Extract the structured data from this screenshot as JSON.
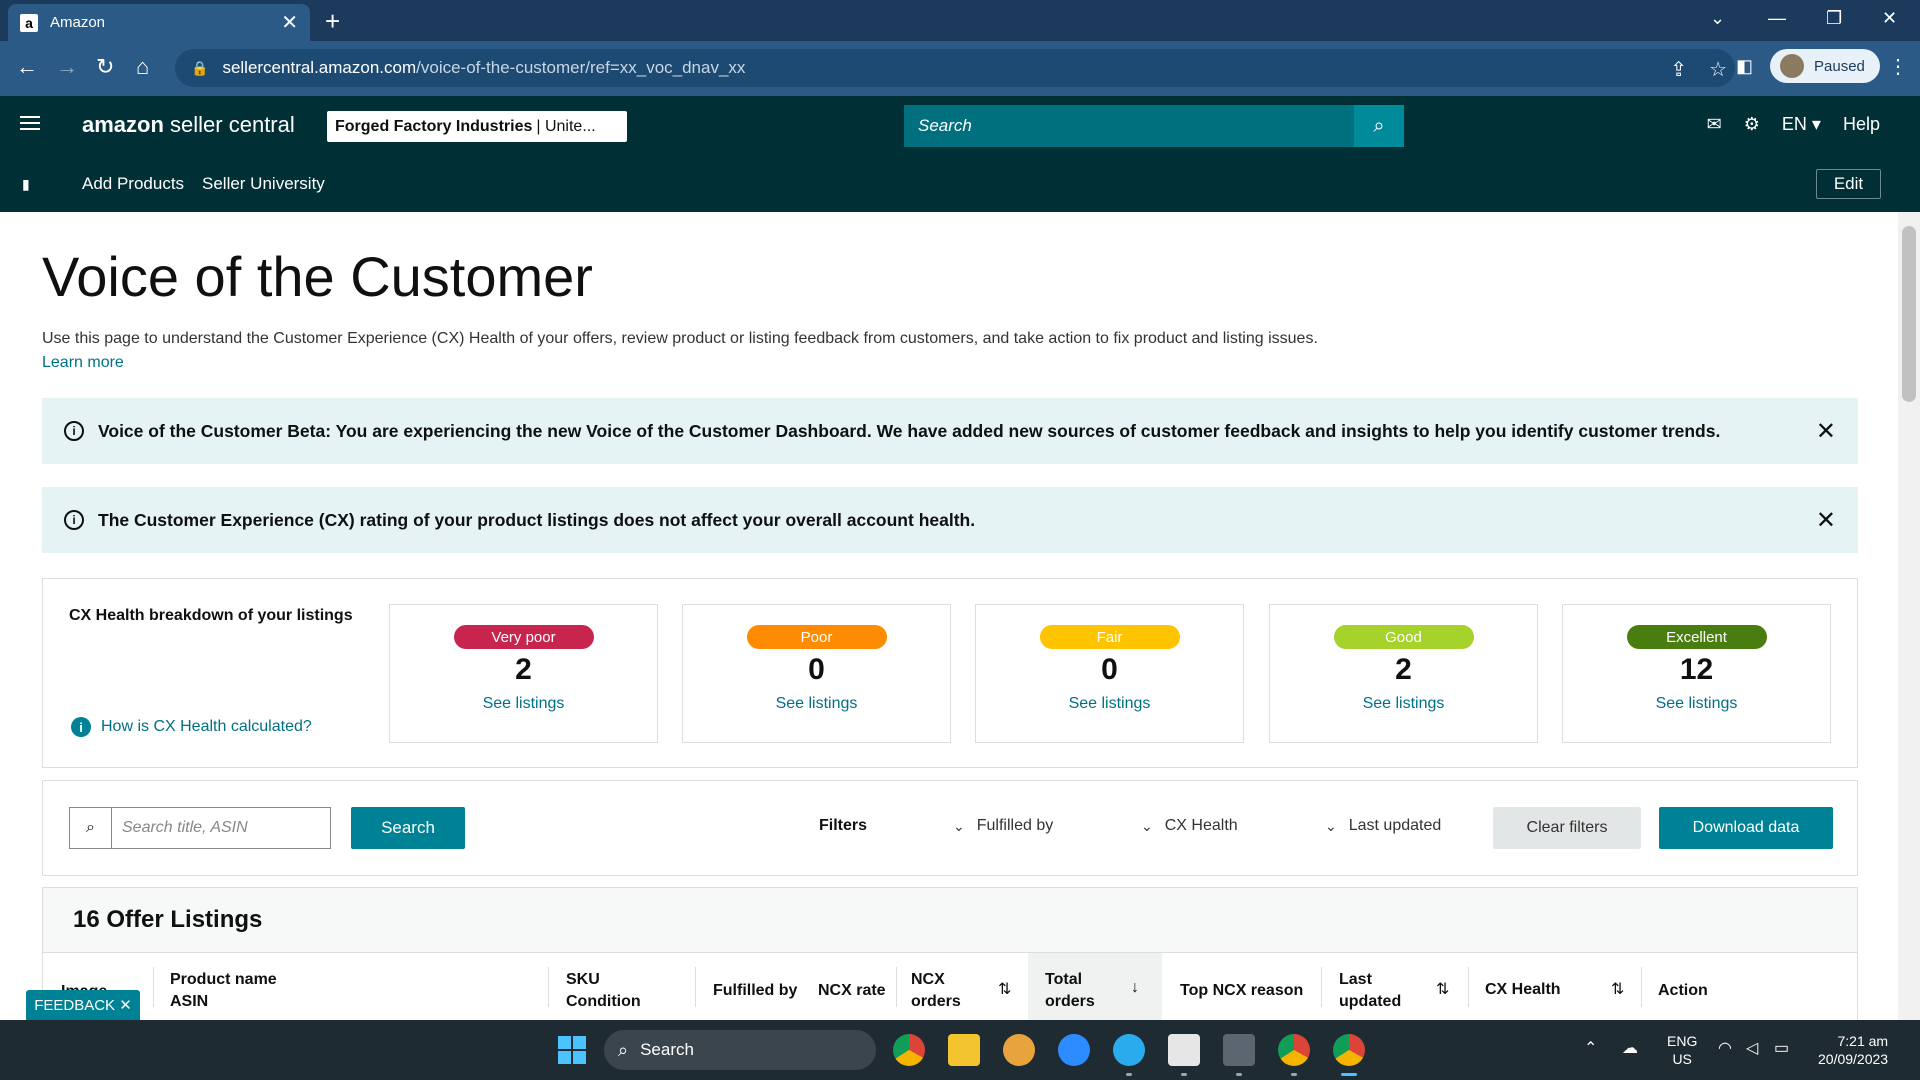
{
  "browser": {
    "tab_title": "Amazon",
    "tab_favicon": "a",
    "tab_close": "✕",
    "new_tab": "+",
    "url_host": "sellercentral.amazon.com",
    "url_path": "/voice-of-the-customer/ref=xx_voc_dnav_xx",
    "profile_status": "Paused"
  },
  "header": {
    "logo_bold": "amazon",
    "logo_rest": " seller central",
    "store_name": "Forged Factory Industries",
    "store_region": "| Unite...",
    "search_placeholder": "Search",
    "language": "EN",
    "help": "Help"
  },
  "nav": {
    "links": [
      "Add Products",
      "Seller University"
    ],
    "edit": "Edit"
  },
  "page": {
    "title": "Voice of the Customer",
    "description": "Use this page to understand the Customer Experience (CX) Health of your offers, review product or listing feedback from customers, and take action to fix product and listing issues.",
    "learn_more": "Learn more"
  },
  "alerts": [
    {
      "text": "Voice of the Customer Beta: You are experiencing the new Voice of the Customer Dashboard. We have added new sources of customer feedback and insights to help you identify customer trends."
    },
    {
      "text": "The Customer Experience (CX) rating of your product listings does not affect your overall account health."
    }
  ],
  "cx_health": {
    "heading": "CX Health breakdown of your listings",
    "help_link": "How is CX Health calculated?",
    "cards": [
      {
        "label": "Very poor",
        "count": "2",
        "link": "See listings",
        "color": "#c7254e"
      },
      {
        "label": "Poor",
        "count": "0",
        "link": "See listings",
        "color": "#ff8c00"
      },
      {
        "label": "Fair",
        "count": "0",
        "link": "See listings",
        "color": "#ffc400"
      },
      {
        "label": "Good",
        "count": "2",
        "link": "See listings",
        "color": "#a5d22b"
      },
      {
        "label": "Excellent",
        "count": "12",
        "link": "See listings",
        "color": "#4a7d0f"
      }
    ]
  },
  "filters": {
    "search_placeholder": "Search title, ASIN",
    "search_button": "Search",
    "label": "Filters",
    "dropdowns": [
      "Fulfilled by",
      "CX Health",
      "Last updated"
    ],
    "clear": "Clear filters",
    "download": "Download data"
  },
  "listings": {
    "title": "16 Offer Listings",
    "columns": {
      "image": "Image",
      "product_name": "Product name",
      "asin": "ASIN",
      "sku": "SKU",
      "condition": "Condition",
      "fulfilled_by": "Fulfilled by",
      "ncx_rate": "NCX rate",
      "ncx_orders_1": "NCX",
      "ncx_orders_2": "orders",
      "total_orders_1": "Total",
      "total_orders_2": "orders",
      "top_ncx_reason": "Top NCX reason",
      "last_updated_1": "Last",
      "last_updated_2": "updated",
      "cx_health": "CX Health",
      "action": "Action"
    }
  },
  "feedback": "FEEDBACK ✕",
  "taskbar": {
    "search": "Search",
    "lang_1": "ENG",
    "lang_2": "US",
    "time": "7:21 am",
    "date": "20/09/2023"
  }
}
